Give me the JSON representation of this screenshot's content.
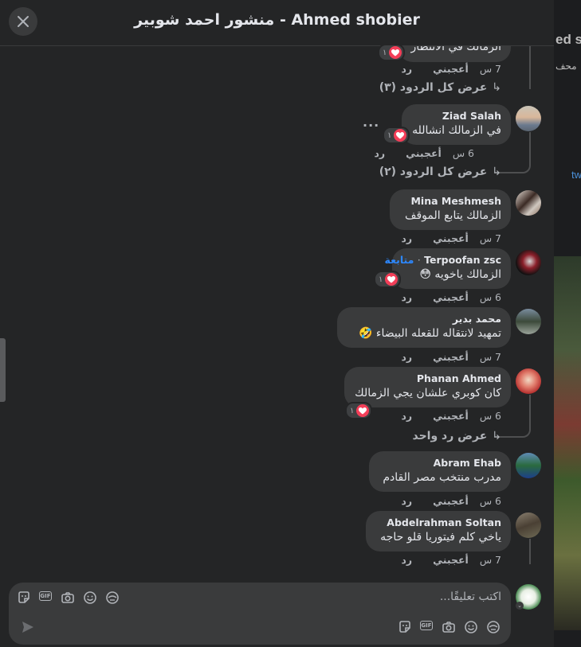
{
  "header": {
    "title": "منشور احمد شوبير - Ahmed shobier"
  },
  "backdrop": {
    "snippet_1": "ed sl",
    "snippet_2": "محف",
    "snippet_3": "tw"
  },
  "top_partial": {
    "text": "الزمالك في الانتظار",
    "reaction_count": "١",
    "time": "7 س",
    "like": "أعجبني",
    "reply": "رد",
    "view_replies": "عرض كل الردود (٣)"
  },
  "comments": [
    {
      "name": "Ziad Salah",
      "text": "في الزمالك انشالله",
      "time": "6 س",
      "like": "أعجبني",
      "reply": "رد",
      "reaction_count": "١",
      "view_replies": "عرض كل الردود (٢)"
    },
    {
      "name": "Mina Meshmesh",
      "text": "الزمالك يتابع الموقف",
      "time": "7 س",
      "like": "أعجبني",
      "reply": "رد"
    },
    {
      "name": "Terpoofan zsc",
      "follow": "متابعة",
      "separator": "·",
      "text": "الزمالك ياخويه 😳",
      "time": "6 س",
      "like": "أعجبني",
      "reply": "رد",
      "reaction_count": "١"
    },
    {
      "name": "محمد بدير",
      "text": "تمهيد لانتقاله للقعله البيضاء 🤣",
      "time": "7 س",
      "like": "أعجبني",
      "reply": "رد"
    },
    {
      "name": "Phanan Ahmed",
      "text": "كان كوبري علشان يجي الزمالك",
      "time": "6 س",
      "like": "أعجبني",
      "reply": "رد",
      "reaction_count": "١",
      "view_replies": "عرض رد واحد"
    },
    {
      "name": "Abram Ehab",
      "text": "مدرب منتخب مصر القادم",
      "time": "6 س",
      "like": "أعجبني",
      "reply": "رد"
    },
    {
      "name": "Abdelrahman Soltan",
      "text": "ياخي كلم فيتوريا قلو حاجه",
      "time": "7 س",
      "like": "أعجبني",
      "reply": "رد"
    }
  ],
  "composer": {
    "placeholder": "اكتب تعليقًا...",
    "gif_label": "GIF"
  },
  "icons": {
    "close": "close-icon",
    "heart": "heart-icon",
    "sticker": "sticker-icon",
    "gif": "gif-icon",
    "camera": "camera-icon",
    "emoji": "emoji-icon",
    "avatar_sticker": "avatar-sticker-icon",
    "send": "send-icon",
    "more": "more-options-icon"
  },
  "colors": {
    "modal_bg": "#242526",
    "bubble_bg": "#3a3b3c",
    "text": "#e4e6eb",
    "muted": "#b0b3b8",
    "link": "#2d88ff",
    "heart": "#f33e58"
  }
}
